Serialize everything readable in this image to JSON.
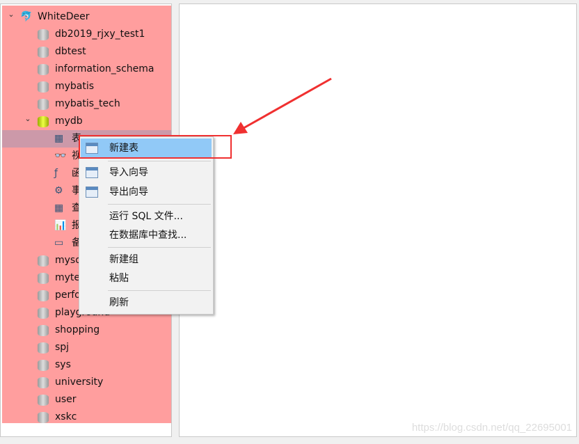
{
  "tree": {
    "connection": "WhiteDeer",
    "databases_before": [
      "db2019_rjxy_test1",
      "dbtest",
      "information_schema",
      "mybatis",
      "mybatis_tech"
    ],
    "open_db": "mydb",
    "children": [
      {
        "label": "表",
        "icon": "table-icon"
      },
      {
        "label": "视图",
        "icon": "view-icon"
      },
      {
        "label": "函数",
        "icon": "function-icon"
      },
      {
        "label": "事件",
        "icon": "event-icon"
      },
      {
        "label": "查询",
        "icon": "query-icon"
      },
      {
        "label": "报表",
        "icon": "report-icon"
      },
      {
        "label": "备份",
        "icon": "backup-icon"
      }
    ],
    "databases_after": [
      "mysql",
      "mytest",
      "performance_schema",
      "playground",
      "shopping",
      "spj",
      "sys",
      "university",
      "user",
      "xskc"
    ]
  },
  "context_menu": {
    "items": [
      "新建表",
      "导入向导",
      "导出向导",
      "运行 SQL 文件...",
      "在数据库中查找...",
      "新建组",
      "粘贴",
      "刷新"
    ]
  },
  "watermark": "https://blog.csdn.net/qq_22695001",
  "colors": {
    "tree_bg": "#ff9e9e",
    "highlight": "#91c9f7",
    "annotation": "#f03030"
  }
}
